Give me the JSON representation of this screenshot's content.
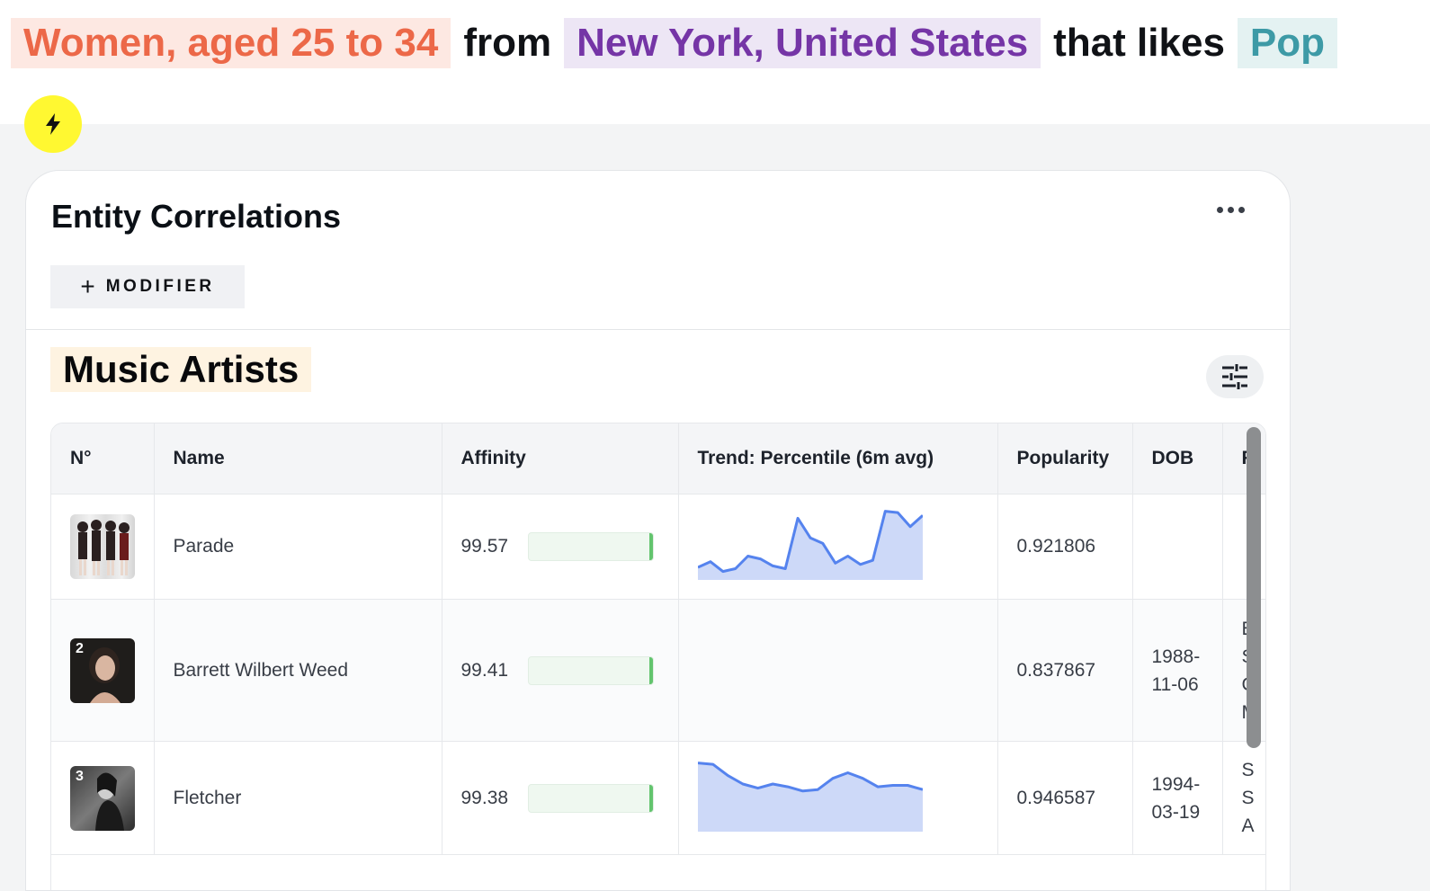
{
  "query": {
    "audience": "Women, aged 25 to 34",
    "connector_from": "from",
    "location": "New York, United States",
    "connector_likes": "that likes",
    "genre": "Pop"
  },
  "action_icon": "lightning-bolt-icon",
  "card": {
    "title": "Entity Correlations",
    "more_icon": "more-horizontal-icon",
    "modifier_label": "MODIFIER",
    "modifier_icon": "plus-icon"
  },
  "section": {
    "title": "Music Artists",
    "filter_icon": "sliders-icon"
  },
  "table": {
    "headers": [
      "N°",
      "Name",
      "Affinity",
      "Trend: Percentile (6m avg)",
      "Popularity",
      "DOB",
      "F"
    ],
    "rows": [
      {
        "rank": "",
        "name": "Parade",
        "affinity": "99.57",
        "popularity": "0.921806",
        "dob_line1": "",
        "dob_line2": "",
        "extra": [
          "",
          "",
          "",
          ""
        ],
        "trend": [
          41,
          37,
          44,
          42,
          33,
          35,
          40,
          42,
          6,
          20,
          24,
          38,
          33,
          39,
          36,
          1,
          2,
          12,
          4
        ]
      },
      {
        "rank": "2",
        "name": "Barrett Wilbert Weed",
        "affinity": "99.41",
        "popularity": "0.837867",
        "dob_line1": "1988-",
        "dob_line2": "11-06",
        "extra": [
          "E",
          "S",
          "C",
          "M"
        ],
        "trend": []
      },
      {
        "rank": "3",
        "name": "Fletcher",
        "affinity": "99.38",
        "popularity": "0.946587",
        "dob_line1": "1994-",
        "dob_line2": "03-19",
        "extra": [
          "S",
          "S",
          "A",
          ""
        ],
        "trend": [
          1,
          2,
          10,
          16,
          19,
          16,
          18,
          21,
          20,
          12,
          8,
          12,
          18,
          17,
          17,
          20
        ]
      }
    ]
  },
  "colors": {
    "audience": "#ec6848",
    "location": "#7535a6",
    "genre": "#3d9aa6",
    "accent_yellow": "#fff831",
    "trend_fill": "#cdd9f8",
    "trend_line": "#5583ee",
    "affinity_bar": "#63c46e"
  }
}
